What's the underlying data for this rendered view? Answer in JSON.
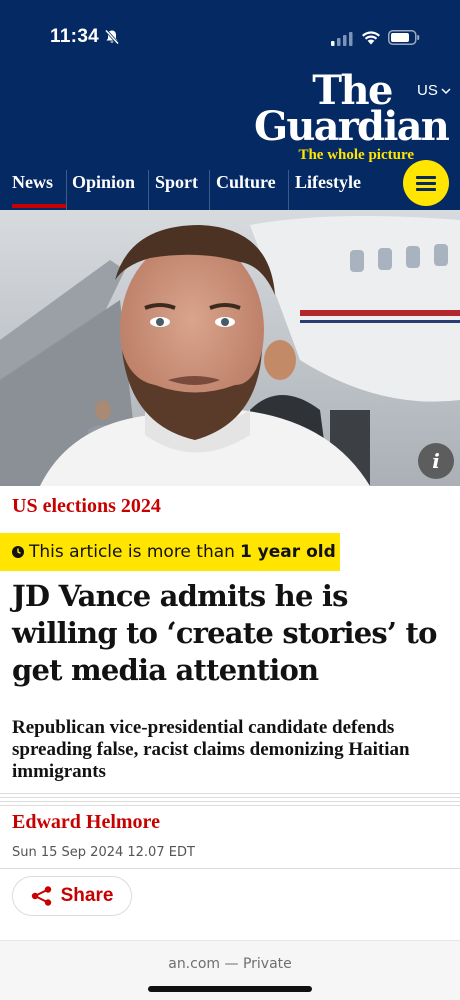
{
  "status_bar": {
    "time": "11:34",
    "icons": [
      "bell-slash-icon",
      "cellular-signal-icon",
      "wifi-icon",
      "battery-icon"
    ]
  },
  "header": {
    "edition": "US",
    "logo_line1": "The",
    "logo_line2": "Guardian",
    "tagline": "The whole picture",
    "background_color": "#052962",
    "accent_color": "#ffe500"
  },
  "nav": {
    "items": [
      {
        "label": "News",
        "active": true
      },
      {
        "label": "Opinion"
      },
      {
        "label": "Sport"
      },
      {
        "label": "Culture"
      },
      {
        "label": "Lifestyle"
      }
    ],
    "menu_icon": "hamburger-menu-icon"
  },
  "hero": {
    "info_label": "i"
  },
  "article": {
    "kicker": "US elections 2024",
    "age_notice_prefix": "This article is more than",
    "age_notice_bold": "1 year old",
    "headline": "JD Vance admits he is willing to ‘create stories’ to get media attention",
    "standfirst": "Republican vice-presidential candidate defends spreading false, racist claims demonizing Haitian immigrants",
    "author": "Edward Helmore",
    "date": "Sun 15 Sep 2024 12.07 EDT",
    "share_label": "Share",
    "kicker_color": "#c70000"
  },
  "browser": {
    "url_text": "an.com — Private"
  }
}
